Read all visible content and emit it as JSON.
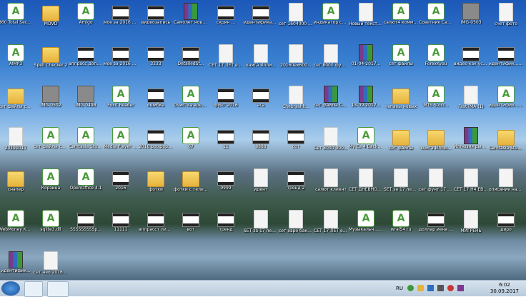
{
  "desktop_icons": [
    {
      "label": "360 Total Security",
      "glyph": "app"
    },
    {
      "label": "MDVD",
      "glyph": "folder"
    },
    {
      "label": "Amigo",
      "glyph": "app"
    },
    {
      "label": "мое за 2016 подарок",
      "glyph": "film"
    },
    {
      "label": "видеозапись",
      "glyph": "film"
    },
    {
      "label": "Самолет нового",
      "glyph": "rar"
    },
    {
      "label": "скрин ...",
      "glyph": "film"
    },
    {
      "label": "идентификац... счета (2)",
      "glyph": "film"
    },
    {
      "label": "сет 1604000 евро фото...",
      "glyph": "file"
    },
    {
      "label": "индикатор совестникл...",
      "glyph": "app"
    },
    {
      "label": "Новый текстов...",
      "glyph": "file"
    },
    {
      "label": "салют4 комментарии",
      "glyph": "app"
    },
    {
      "label": "Советник Салют 2 А...",
      "glyph": "app"
    },
    {
      "label": "IMG-0503",
      "glyph": "img"
    },
    {
      "label": "счет фото",
      "glyph": "file"
    },
    {
      "label": "AIMP3",
      "glyph": "app"
    },
    {
      "label": "Spell Checker 2",
      "glyph": "folder"
    },
    {
      "label": "аппрасс доплата",
      "glyph": "film"
    },
    {
      "label": "мое за 2016 год",
      "glyph": "film"
    },
    {
      "label": "3333",
      "glyph": "film"
    },
    {
      "label": "DetailedSt...",
      "glyph": "film"
    },
    {
      "label": "СЕТ 17 ЛЕТ евро бакс...",
      "glyph": "file"
    },
    {
      "label": "книга Илли...",
      "glyph": "file"
    },
    {
      "label": "20160ex600...",
      "glyph": "file"
    },
    {
      "label": "сет 8000 фунт доля...",
      "glyph": "file"
    },
    {
      "label": "01-04-2017...",
      "glyph": "rar"
    },
    {
      "label": "сет файлы",
      "glyph": "app"
    },
    {
      "label": "ForexKyou",
      "glyph": "app"
    },
    {
      "label": "видео как установить...",
      "glyph": "film"
    },
    {
      "label": "идентифик... счета",
      "glyph": "film"
    },
    {
      "label": "сет файлы салюта",
      "glyph": "folder"
    },
    {
      "label": "IMG-0502",
      "glyph": "img"
    },
    {
      "label": "IMG-0498",
      "glyph": "img"
    },
    {
      "label": "Foxit Reader",
      "glyph": "app"
    },
    {
      "label": "ошибка",
      "glyph": "film"
    },
    {
      "label": "Очистка временн...",
      "glyph": "app"
    },
    {
      "label": "фунт 2016",
      "glyph": "film"
    },
    {
      "label": "ага",
      "glyph": "film"
    },
    {
      "label": "Chebrashk...",
      "glyph": "file"
    },
    {
      "label": "сет файлы САЛЮТА",
      "glyph": "rar"
    },
    {
      "label": "13-09-2017...",
      "glyph": "rar"
    },
    {
      "label": "чапаеы новых",
      "glyph": "folder"
    },
    {
      "label": "MTS Stocr...",
      "glyph": "app"
    },
    {
      "label": "FastTMA (1)",
      "glyph": "file"
    },
    {
      "label": "идентифик... (2)",
      "glyph": "app"
    },
    {
      "label": "20191017",
      "glyph": "file"
    },
    {
      "label": "сет файлы салюта",
      "glyph": "app"
    },
    {
      "label": "Camtasia Studio 6",
      "glyph": "app"
    },
    {
      "label": "Media Player Classic",
      "glyph": "app"
    },
    {
      "label": "2016 роофорекс",
      "glyph": "film"
    },
    {
      "label": "67",
      "glyph": "app"
    },
    {
      "label": "11",
      "glyph": "film"
    },
    {
      "label": "8888",
      "glyph": "film"
    },
    {
      "label": "сот",
      "glyph": "film"
    },
    {
      "label": "Сет 3000 000 за 2016 до...",
      "glyph": "file"
    },
    {
      "label": "My Ea 4 BackUp 2",
      "glyph": "app"
    },
    {
      "label": "сет файлы",
      "glyph": "folder"
    },
    {
      "label": "книга Иллю...",
      "glyph": "folder"
    },
    {
      "label": "Иллюзия рынка",
      "glyph": "rar"
    },
    {
      "label": "Camtasia Studio 8.6",
      "glyph": "folder"
    },
    {
      "label": "снапер",
      "glyph": "folder"
    },
    {
      "label": "Корзина",
      "glyph": "app"
    },
    {
      "label": "OpenOffice 4.1",
      "glyph": "app"
    },
    {
      "label": "2016",
      "glyph": "film"
    },
    {
      "label": "фотки",
      "glyph": "folder"
    },
    {
      "label": "фотки с телефона",
      "glyph": "folder"
    },
    {
      "label": "9999",
      "glyph": "film"
    },
    {
      "label": "идент",
      "glyph": "file"
    },
    {
      "label": "тренд 2",
      "glyph": "film"
    },
    {
      "label": "салют клиент",
      "glyph": "file"
    },
    {
      "label": "СЕТ ДНЕВНОЙ С...",
      "glyph": "file"
    },
    {
      "label": "SET за 17 лет прибыль...",
      "glyph": "file"
    },
    {
      "label": "сет фунт 17 лет.set",
      "glyph": "file"
    },
    {
      "label": "СЕТ 17 Н4 ЕВРО БАКС...",
      "glyph": "file"
    },
    {
      "label": "описание настроек",
      "glyph": "file"
    },
    {
      "label": "WebMoney Keeper W...",
      "glyph": "app"
    },
    {
      "label": "sqlite3.dll",
      "glyph": "app"
    },
    {
      "label": "SSSSSSSSSp...",
      "glyph": "film"
    },
    {
      "label": "11111",
      "glyph": "film"
    },
    {
      "label": "аппрасст лишни...",
      "glyph": "film"
    },
    {
      "label": "вот",
      "glyph": "film"
    },
    {
      "label": "тренд",
      "glyph": "film"
    },
    {
      "label": "SET за 17 лет прибыль...",
      "glyph": "file"
    },
    {
      "label": "сет евро бакс Н1 с...",
      "glyph": "file"
    },
    {
      "label": "СЕТ 17 ЛЕТ евро бакс...",
      "glyph": "file"
    },
    {
      "label": "Музыкальн... конвертер",
      "glyph": "app"
    },
    {
      "label": "wral54.ru",
      "glyph": "app"
    },
    {
      "label": "доллар иена 2016",
      "glyph": "film"
    },
    {
      "label": "МИГРЕНЬ",
      "glyph": "file"
    },
    {
      "label": "диро",
      "glyph": "film"
    },
    {
      "label": "идентифик...",
      "glyph": "rar"
    },
    {
      "label": "сет нео 2016.set",
      "glyph": "file"
    }
  ],
  "taskbar": {
    "language": "RU",
    "time": "6:02",
    "date": "30.09.2017"
  }
}
